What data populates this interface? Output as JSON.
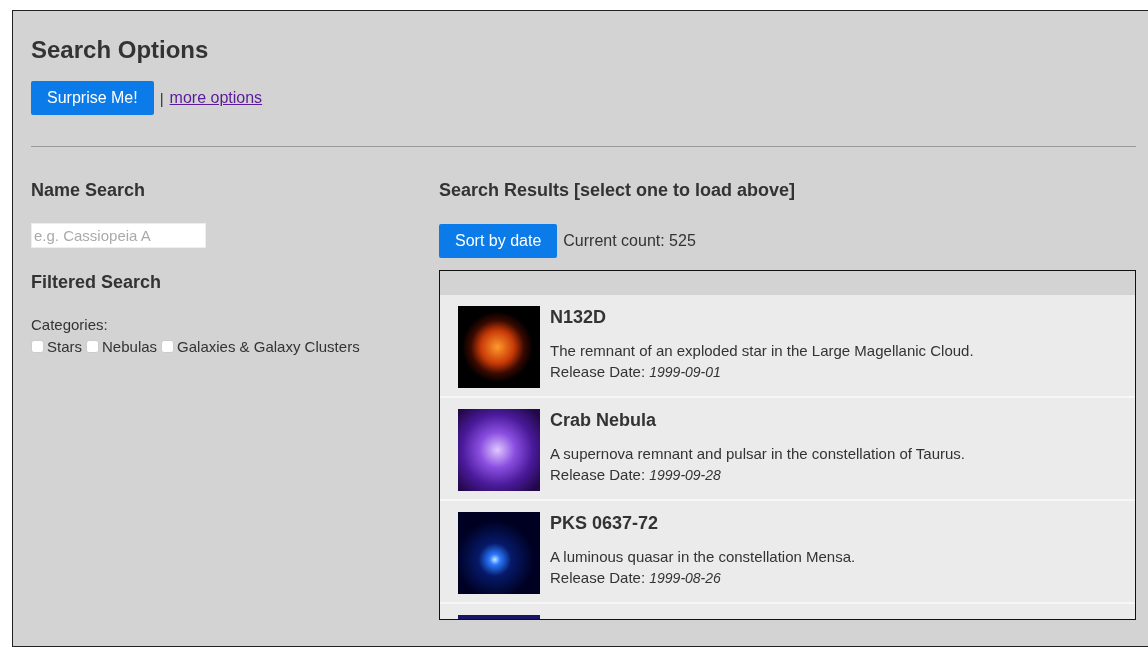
{
  "title": "Search Options",
  "surprise_button": "Surprise Me!",
  "separator": "|",
  "more_options_link": "more options",
  "name_search": {
    "heading": "Name Search",
    "placeholder": "e.g. Cassiopeia A"
  },
  "filtered_search": {
    "heading": "Filtered Search",
    "categories_label": "Categories:",
    "categories": [
      {
        "label": "Stars",
        "checked": false
      },
      {
        "label": "Nebulas",
        "checked": false
      },
      {
        "label": "Galaxies & Galaxy Clusters",
        "checked": false
      }
    ]
  },
  "results": {
    "heading": "Search Results [select one to load above]",
    "sort_button": "Sort by date",
    "count": "Current count: 525",
    "items": [
      {
        "name": "N132D",
        "description": "The remnant of an exploded star in the Large Magellanic Cloud.",
        "date_label": "Release Date:",
        "date": "1999-09-01"
      },
      {
        "name": "Crab Nebula",
        "description": "A supernova remnant and pulsar in the constellation of Taurus.",
        "date_label": "Release Date:",
        "date": "1999-09-28"
      },
      {
        "name": "PKS 0637-72",
        "description": "A luminous quasar in the constellation Mensa.",
        "date_label": "Release Date:",
        "date": "1999-08-26"
      }
    ]
  }
}
